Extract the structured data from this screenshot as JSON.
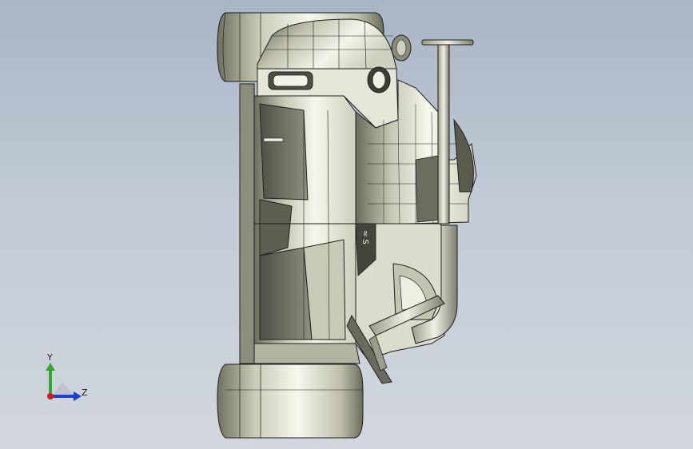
{
  "viewport": {
    "background_top": "#aab5c4",
    "background_bottom": "#d2d7dd"
  },
  "model": {
    "name": "",
    "view_orientation": "side",
    "colors": {
      "surface_light": "#f4f4ea",
      "surface_mid": "#d9d9c8",
      "surface_dark": "#8e8f7e",
      "surface_shadow": "#55564c",
      "edge": "#1e1e1e"
    },
    "decal_text": "≈ S"
  },
  "triad": {
    "y_label": "Y",
    "z_label": "Z",
    "x_color": "#d01a1a",
    "y_color": "#2faa2f",
    "z_color": "#1d3fd8"
  }
}
